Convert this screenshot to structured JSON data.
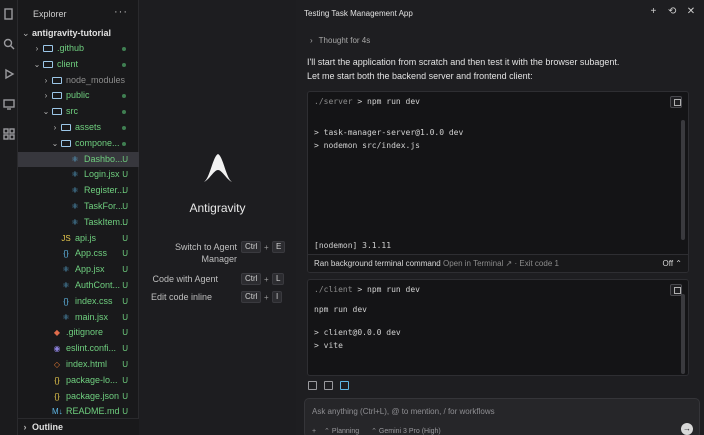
{
  "explorer": {
    "title": "Explorer",
    "more_label": "···",
    "root": "antigravity-tutorial",
    "items": [
      {
        "label": ".github",
        "kind": "folder",
        "indent": 1,
        "open": false,
        "status": "dot"
      },
      {
        "label": "client",
        "kind": "folder",
        "indent": 1,
        "open": true,
        "status": "dot"
      },
      {
        "label": "node_modules",
        "kind": "folder",
        "indent": 2,
        "open": false,
        "status": ""
      },
      {
        "label": "public",
        "kind": "folder",
        "indent": 2,
        "open": false,
        "status": "dot"
      },
      {
        "label": "src",
        "kind": "folder",
        "indent": 2,
        "open": true,
        "status": "dot"
      },
      {
        "label": "assets",
        "kind": "folder",
        "indent": 3,
        "open": false,
        "status": "dot"
      },
      {
        "label": "compone...",
        "kind": "folder",
        "indent": 3,
        "open": true,
        "status": "dot"
      },
      {
        "label": "Dashbo...",
        "kind": "react",
        "indent": 4,
        "status": "U",
        "selected": true
      },
      {
        "label": "Login.jsx",
        "kind": "react",
        "indent": 4,
        "status": "U"
      },
      {
        "label": "Register...",
        "kind": "react",
        "indent": 4,
        "status": "U"
      },
      {
        "label": "TaskFor...",
        "kind": "react",
        "indent": 4,
        "status": "U"
      },
      {
        "label": "TaskItem...",
        "kind": "react",
        "indent": 4,
        "status": "U"
      },
      {
        "label": "api.js",
        "kind": "js",
        "indent": 3,
        "status": "U"
      },
      {
        "label": "App.css",
        "kind": "css",
        "indent": 3,
        "status": "U"
      },
      {
        "label": "App.jsx",
        "kind": "react",
        "indent": 3,
        "status": "U"
      },
      {
        "label": "AuthCont...",
        "kind": "react",
        "indent": 3,
        "status": "U"
      },
      {
        "label": "index.css",
        "kind": "css",
        "indent": 3,
        "status": "U"
      },
      {
        "label": "main.jsx",
        "kind": "react",
        "indent": 3,
        "status": "U"
      },
      {
        "label": ".gitignore",
        "kind": "git",
        "indent": 2,
        "status": "U"
      },
      {
        "label": "eslint.confi...",
        "kind": "eslint",
        "indent": 2,
        "status": "U"
      },
      {
        "label": "index.html",
        "kind": "html",
        "indent": 2,
        "status": "U"
      },
      {
        "label": "package-lo...",
        "kind": "json",
        "indent": 2,
        "status": "U"
      },
      {
        "label": "package.json",
        "kind": "json",
        "indent": 2,
        "status": "U"
      },
      {
        "label": "README.md",
        "kind": "md",
        "indent": 2,
        "status": "U"
      }
    ],
    "outline": "Outline"
  },
  "center": {
    "brand": "Antigravity",
    "shortcuts": [
      {
        "label_line1": "Switch to Agent",
        "label_line2": "Manager",
        "key1": "Ctrl",
        "key2": "E"
      },
      {
        "label_line1": "Code with Agent",
        "label_line2": "",
        "key1": "Ctrl",
        "key2": "L"
      },
      {
        "label_line1": "Edit code inline",
        "label_line2": "",
        "key1": "Ctrl",
        "key2": "I"
      }
    ],
    "plus": "+"
  },
  "chat": {
    "title": "Testing Task Management App",
    "actions": {
      "new": "+",
      "history": "⟲",
      "close": "✕"
    },
    "thought": "Thought for 4s",
    "message_line1": "I'll start the application from scratch and then test it with the browser subagent.",
    "message_line2": "Let me start both the backend server and frontend client:",
    "terminal1": {
      "path": "./server",
      "prompt": ">",
      "command": "npm run dev",
      "lines": [
        "> task-manager-server@1.0.0 dev",
        "> nodemon src/index.js"
      ],
      "last_line": "[nodemon] 3.1.11",
      "footer_label": "Ran background terminal command",
      "footer_link": "Open in Terminal",
      "footer_exit": "· Exit code 1",
      "footer_toggle": "Off"
    },
    "terminal2": {
      "path": "./client",
      "prompt": ">",
      "command": "npm run dev",
      "lines": [
        "npm run dev",
        "> client@0.0.0 dev",
        "> vite"
      ]
    },
    "input_placeholder": "Ask anything (Ctrl+L), @ to mention, / for workflows",
    "mode": "Planning",
    "model": "Gemini 3 Pro (High)"
  },
  "colors": {
    "accent": "#6fcf7f",
    "folder": "#9cc7e8",
    "react": "#5fb8e6"
  }
}
